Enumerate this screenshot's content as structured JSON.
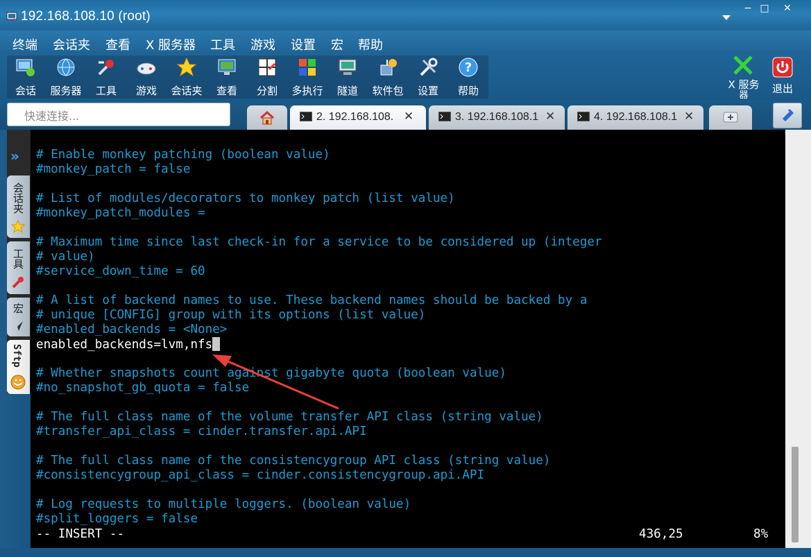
{
  "window": {
    "title": "192.168.108.10 (root)",
    "minimize_symbol": "−",
    "maximize_symbol": "□",
    "close_symbol": "✕"
  },
  "menu": [
    "终端",
    "会话夹",
    "查看",
    "X 服务器",
    "工具",
    "游戏",
    "设置",
    "宏",
    "帮助"
  ],
  "toolbar": {
    "tools": [
      {
        "label": "会话",
        "icon": "session-icon"
      },
      {
        "label": "服务器",
        "icon": "globe-icon"
      },
      {
        "label": "工具",
        "icon": "tools-icon"
      },
      {
        "label": "游戏",
        "icon": "gamepad-icon"
      },
      {
        "label": "会话夹",
        "icon": "star-icon"
      },
      {
        "label": "查看",
        "icon": "monitor-icon"
      },
      {
        "label": "分割",
        "icon": "split-icon"
      },
      {
        "label": "多执行",
        "icon": "multiexec-icon"
      },
      {
        "label": "隧道",
        "icon": "tunnel-icon"
      },
      {
        "label": "软件包",
        "icon": "packages-icon"
      },
      {
        "label": "设置",
        "icon": "settings-icon"
      },
      {
        "label": "帮助",
        "icon": "help-icon"
      }
    ],
    "xserver_label_line1": "X 服务",
    "xserver_label_line2": "器",
    "exit_label": "退出"
  },
  "quick_connect": {
    "placeholder": "快速连接..."
  },
  "tabs": [
    {
      "label": "2. 192.168.108.",
      "active": true
    },
    {
      "label": "3. 192.168.108.1",
      "active": false
    },
    {
      "label": "4. 192.168.108.1",
      "active": false
    }
  ],
  "side_tabs": [
    "会话夹",
    "工具",
    "宏",
    "Sftp"
  ],
  "terminal": {
    "lines": [
      "# Enable monkey patching (boolean value)",
      "#monkey_patch = false",
      "",
      "# List of modules/decorators to monkey patch (list value)",
      "#monkey_patch_modules =",
      "",
      "# Maximum time since last check-in for a service to be considered up (integer",
      "# value)",
      "#service_down_time = 60",
      "",
      "# A list of backend names to use. These backend names should be backed by a",
      "# unique [CONFIG] group with its options (list value)",
      "#enabled_backends = <None>",
      "enabled_backends=lvm,nfs",
      "",
      "# Whether snapshots count against gigabyte quota (boolean value)",
      "#no_snapshot_gb_quota = false",
      "",
      "# The full class name of the volume transfer API class (string value)",
      "#transfer_api_class = cinder.transfer.api.API",
      "",
      "# The full class name of the consistencygroup API class (string value)",
      "#consistencygroup_api_class = cinder.consistencygroup.api.API",
      "",
      "# Log requests to multiple loggers. (boolean value)",
      "#split_loggers = false"
    ],
    "edited_line_index": 13,
    "status_mode": "-- INSERT --",
    "status_position": "436,25",
    "status_percent": "8%",
    "text_color": "#1f9bd1",
    "edited_color": "#ffffff",
    "annotation_arrow_color": "#e8403a"
  }
}
